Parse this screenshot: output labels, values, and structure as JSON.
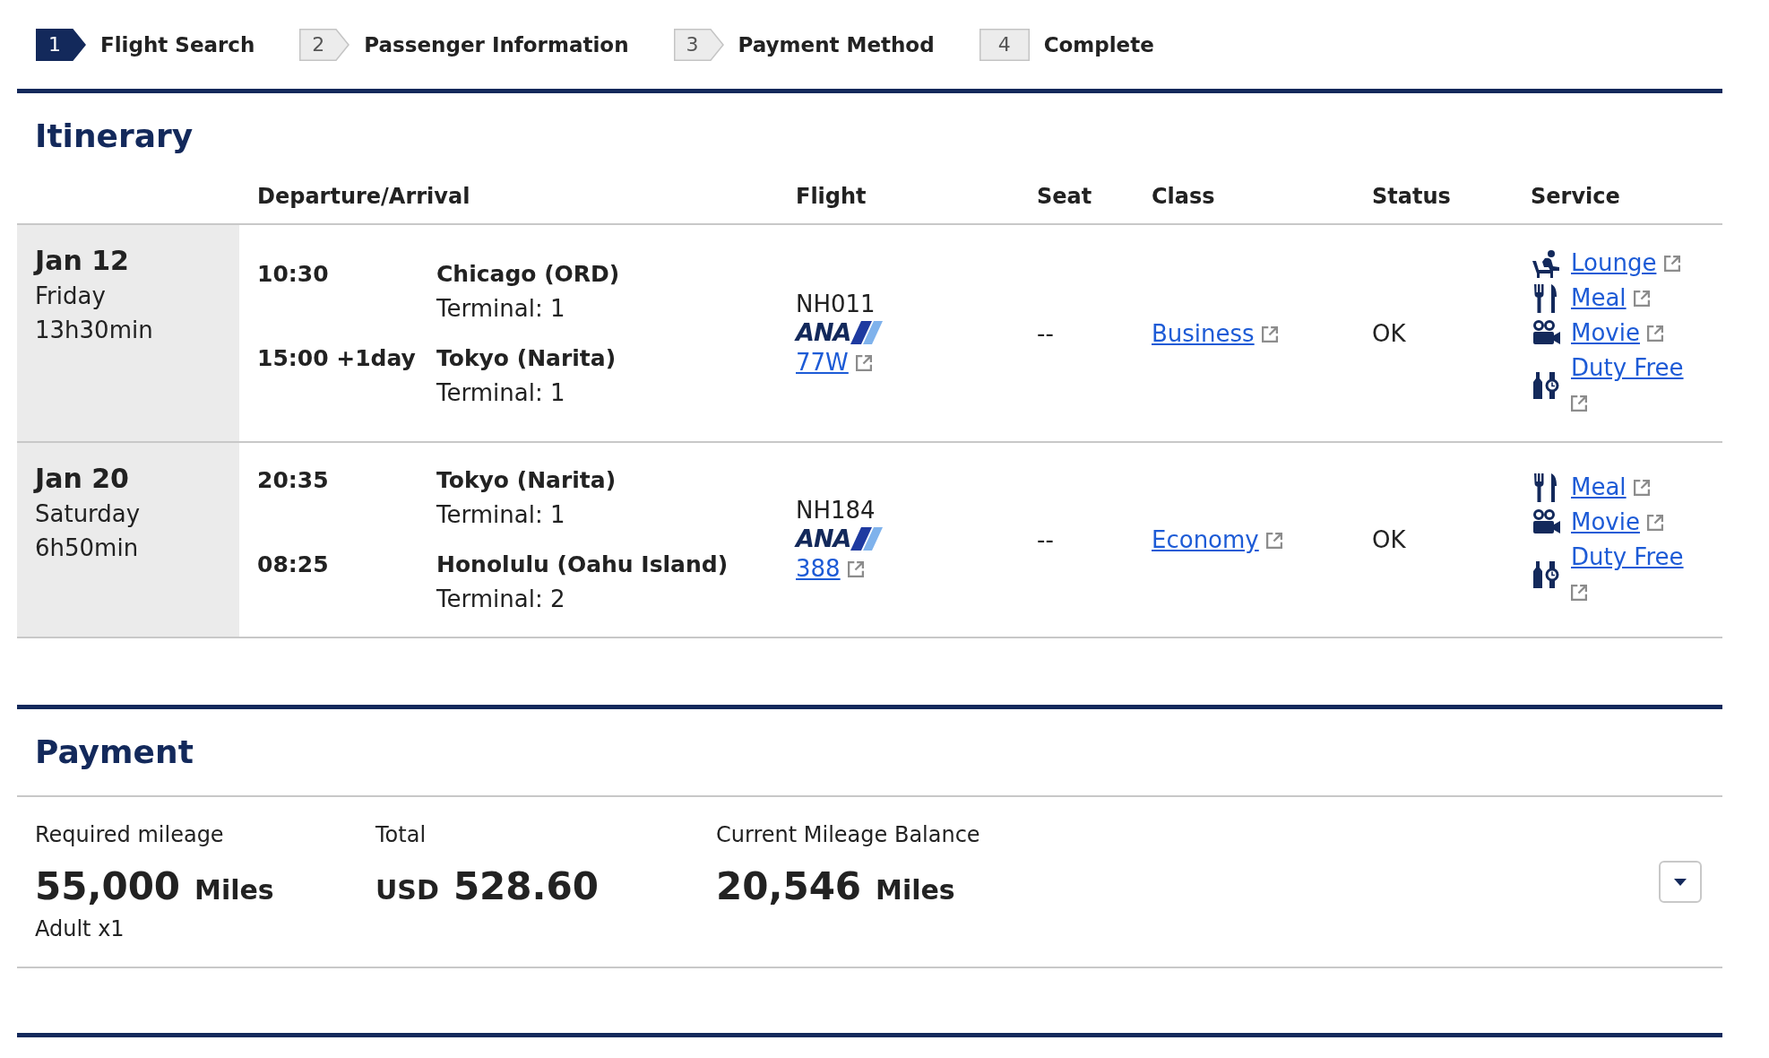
{
  "steps": [
    {
      "number": "1",
      "label": "Flight Search",
      "selected": true
    },
    {
      "number": "2",
      "label": "Passenger Information",
      "selected": false
    },
    {
      "number": "3",
      "label": "Payment Method",
      "selected": false
    },
    {
      "number": "4",
      "label": "Complete",
      "selected": false
    }
  ],
  "itinerary": {
    "title": "Itinerary",
    "columns": [
      "Departure/Arrival",
      "Flight",
      "Seat",
      "Class",
      "Status",
      "Service"
    ],
    "rows": [
      {
        "date": "Jan 12",
        "weekday": "Friday",
        "duration": "13h30min",
        "segments": [
          {
            "time": "10:30",
            "place": "Chicago (ORD)",
            "terminal": "Terminal: 1"
          },
          {
            "time": "15:00 +1day",
            "place": "Tokyo (Narita)",
            "terminal": "Terminal: 1"
          }
        ],
        "flight_number": "NH011",
        "airline_logo": "ANA",
        "aircraft": "77W",
        "seat": "--",
        "class": "Business",
        "status": "OK",
        "services": [
          {
            "kind": "lounge",
            "label": "Lounge"
          },
          {
            "kind": "meal",
            "label": "Meal"
          },
          {
            "kind": "movie",
            "label": "Movie"
          },
          {
            "kind": "duty_free",
            "label": "Duty Free"
          }
        ]
      },
      {
        "date": "Jan 20",
        "weekday": "Saturday",
        "duration": "6h50min",
        "segments": [
          {
            "time": "20:35",
            "place": "Tokyo (Narita)",
            "terminal": "Terminal: 1"
          },
          {
            "time": "08:25",
            "place": "Honolulu (Oahu Island)",
            "terminal": "Terminal: 2"
          }
        ],
        "flight_number": "NH184",
        "airline_logo": "ANA",
        "aircraft": "388",
        "seat": "--",
        "class": "Economy",
        "status": "OK",
        "services": [
          {
            "kind": "meal",
            "label": "Meal"
          },
          {
            "kind": "movie",
            "label": "Movie"
          },
          {
            "kind": "duty_free",
            "label": "Duty Free"
          }
        ]
      }
    ]
  },
  "payment": {
    "title": "Payment",
    "required_mileage": {
      "label": "Required mileage",
      "amount": "55,000",
      "unit": "Miles",
      "note": "Adult x1"
    },
    "total": {
      "label": "Total",
      "currency": "USD",
      "amount": "528.60"
    },
    "balance": {
      "label": "Current Mileage Balance",
      "amount": "20,546",
      "unit": "Miles"
    }
  }
}
